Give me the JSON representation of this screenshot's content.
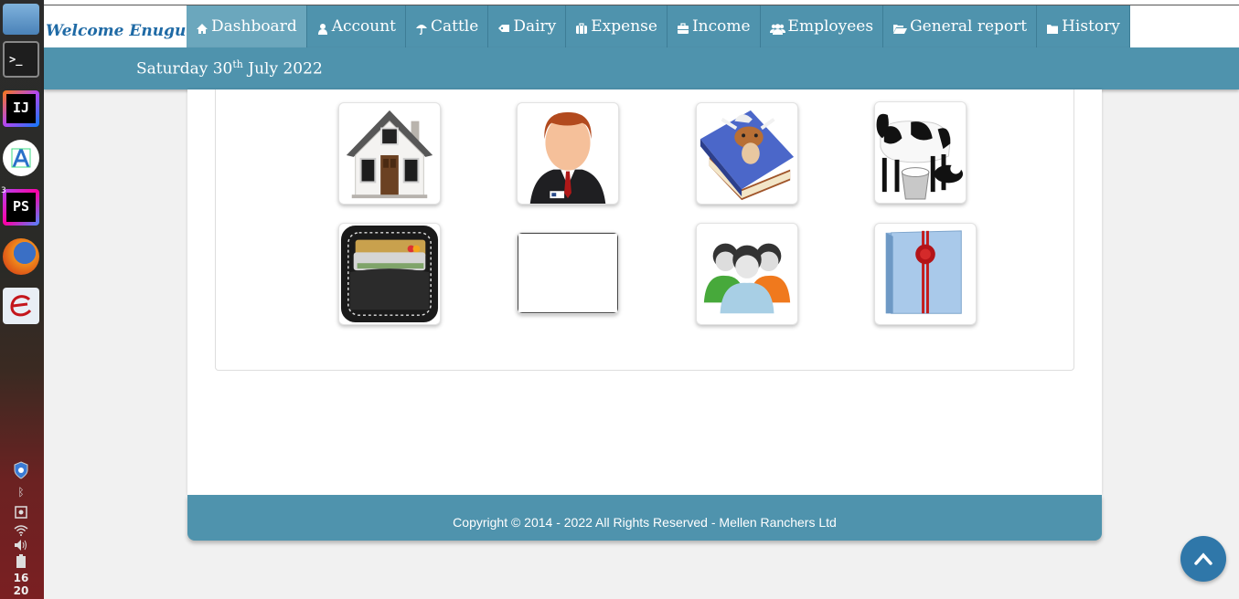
{
  "launcher": {
    "items": [
      {
        "name": "files-icon"
      },
      {
        "name": "terminal-icon"
      },
      {
        "name": "intellij-icon",
        "label": "IJ"
      },
      {
        "name": "android-studio-icon"
      },
      {
        "name": "phpstorm-icon",
        "label": "PS",
        "badge": "3"
      },
      {
        "name": "firefox-icon"
      },
      {
        "name": "eclipse-icon"
      }
    ],
    "clock": {
      "hour": "16",
      "minute": "20"
    }
  },
  "navbar": {
    "brand": "Welcome Enugu",
    "items": [
      {
        "label": "Dashboard",
        "icon": "home-icon",
        "active": true
      },
      {
        "label": "Account",
        "icon": "user-icon"
      },
      {
        "label": "Cattle",
        "icon": "umbrella-icon"
      },
      {
        "label": "Dairy",
        "icon": "tag-icon"
      },
      {
        "label": "Expense",
        "icon": "suitcase-icon"
      },
      {
        "label": "Income",
        "icon": "briefcase-icon"
      },
      {
        "label": "Employees",
        "icon": "users-icon"
      },
      {
        "label": "General report",
        "icon": "folder-open-icon"
      },
      {
        "label": "History",
        "icon": "folder-icon"
      }
    ]
  },
  "date": {
    "weekday": "Saturday",
    "day": "30",
    "suffix": "th",
    "month_year": "July 2022"
  },
  "dashboard": {
    "tiles": [
      {
        "name": "home-tile",
        "icon": "house-icon"
      },
      {
        "name": "account-tile",
        "icon": "businessman-icon"
      },
      {
        "name": "cattle-tile",
        "icon": "cattle-book-icon"
      },
      {
        "name": "dairy-tile",
        "icon": "cow-milk-icon"
      },
      {
        "name": "expense-tile",
        "icon": "wallet-icon"
      },
      {
        "name": "income-tile",
        "icon": "blank-image"
      },
      {
        "name": "employees-tile",
        "icon": "people-icon"
      },
      {
        "name": "report-tile",
        "icon": "folder-seal-icon"
      }
    ]
  },
  "footer": {
    "text": "Copyright © 2014 - 2022 All Rights Reserved - Mellen Ranchers Ltd"
  },
  "colors": {
    "accent": "#4f93ad",
    "active_nav": "#6ba7bd",
    "brand": "#1f6aa5",
    "scroll_button": "#2f77a9"
  }
}
